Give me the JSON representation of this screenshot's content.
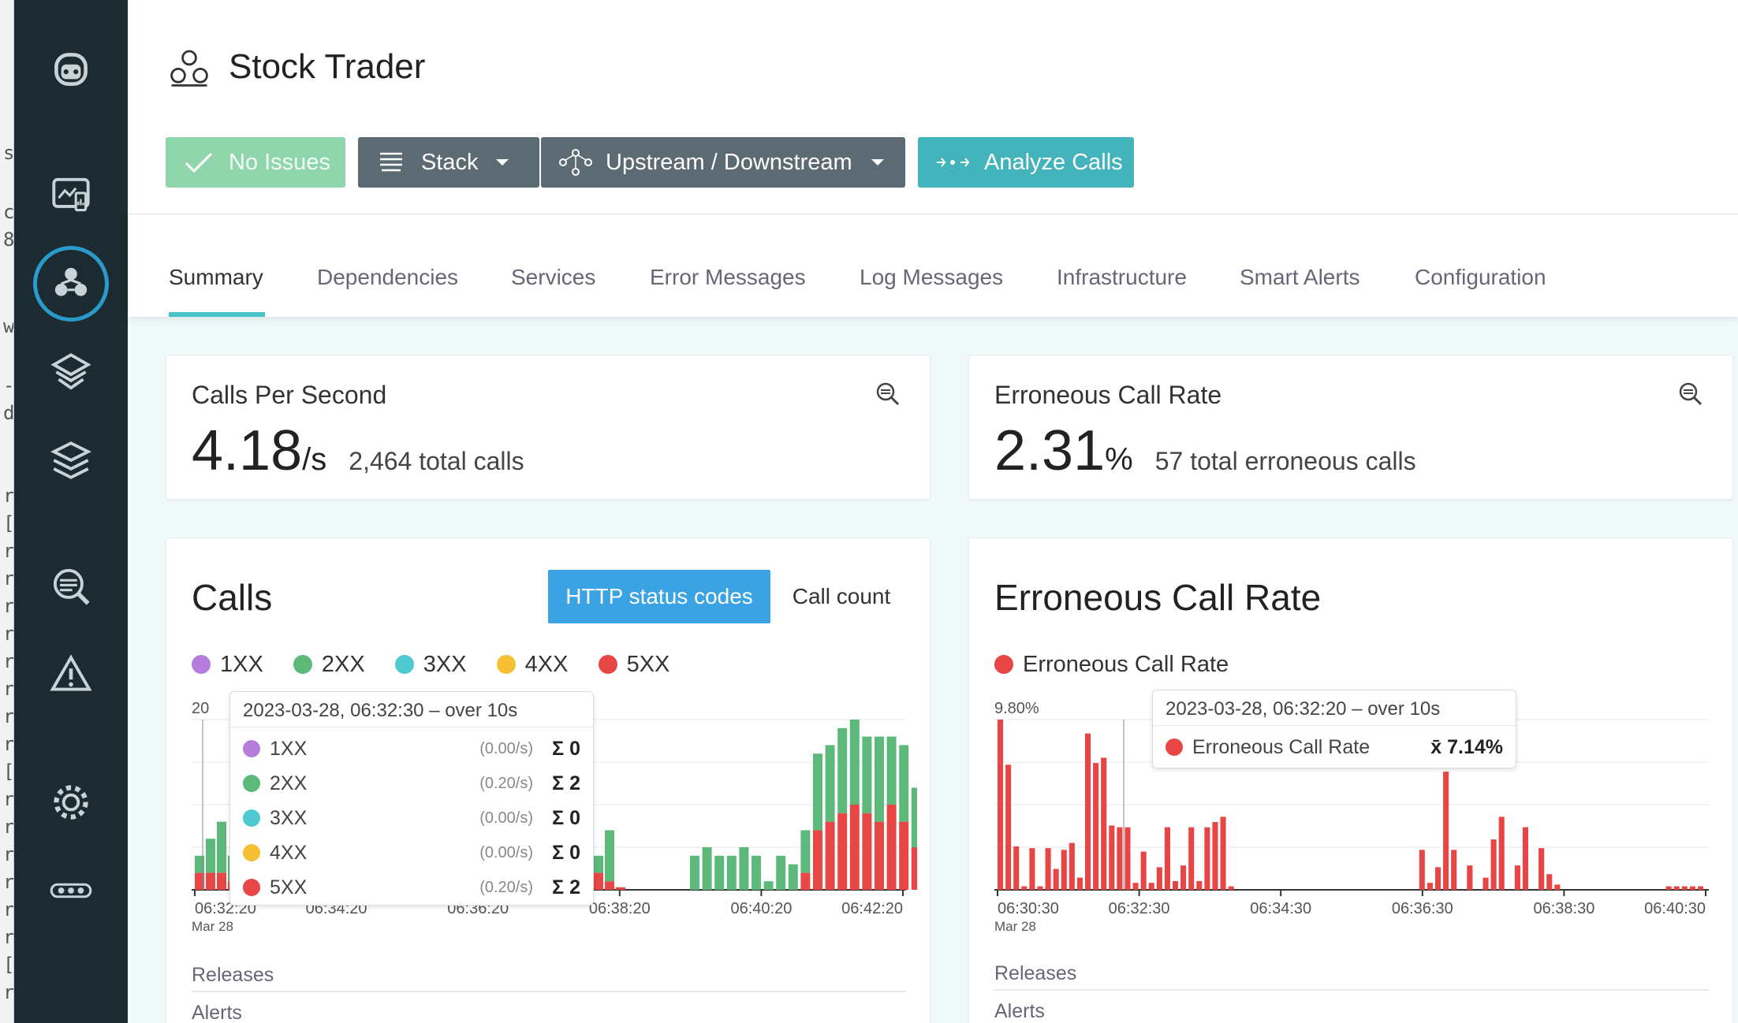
{
  "app": {
    "title": "Stock Trader"
  },
  "toolbar": {
    "no_issues": "No Issues",
    "stack": "Stack",
    "upstream": "Upstream / Downstream",
    "analyze": "Analyze Calls"
  },
  "tabs": [
    "Summary",
    "Dependencies",
    "Services",
    "Error Messages",
    "Log Messages",
    "Infrastructure",
    "Smart Alerts",
    "Configuration"
  ],
  "sidebar": {
    "icons": [
      "robot-logo-icon",
      "dashboard-icon",
      "application-icon",
      "service-icon",
      "layers-icon",
      "analyze-icon",
      "alert-icon",
      "settings-icon",
      "more-icon"
    ]
  },
  "kpi": {
    "calls": {
      "title": "Calls Per Second",
      "value": "4.18",
      "unit": "/s",
      "sub": "2,464 total calls"
    },
    "errors": {
      "title": "Erroneous Call Rate",
      "value": "2.31",
      "unit": "%",
      "sub": "57 total erroneous calls"
    }
  },
  "calls_card": {
    "title": "Calls",
    "toggle": [
      "HTTP status codes",
      "Call count"
    ],
    "releases": "Releases",
    "alerts": "Alerts",
    "tooltip": {
      "header": "2023-03-28, 06:32:30 – over 10s",
      "rows": [
        {
          "name": "1XX",
          "rate": "(0.00/s)",
          "sum": "0"
        },
        {
          "name": "2XX",
          "rate": "(0.20/s)",
          "sum": "2"
        },
        {
          "name": "3XX",
          "rate": "(0.00/s)",
          "sum": "0"
        },
        {
          "name": "4XX",
          "rate": "(0.00/s)",
          "sum": "0"
        },
        {
          "name": "5XX",
          "rate": "(0.20/s)",
          "sum": "2"
        }
      ]
    }
  },
  "err_card": {
    "title": "Erroneous Call Rate",
    "releases": "Releases",
    "alerts": "Alerts",
    "tooltip": {
      "header": "2023-03-28, 06:32:20 – over 10s",
      "name": "Erroneous Call Rate",
      "value": "7.14%"
    }
  },
  "colors": {
    "1XX": "#b57edc",
    "2XX": "#5cb97a",
    "3XX": "#4ec9d0",
    "4XX": "#f5c033",
    "5XX": "#e84545",
    "accent": "#48c1c8",
    "nav": "#1b2b31"
  },
  "chart_data": [
    {
      "type": "bar",
      "title": "Calls",
      "stacked": true,
      "ylim": [
        0,
        20
      ],
      "ytick_top": "20",
      "xticks": [
        "06:32:20",
        "06:34:20",
        "06:36:20",
        "06:38:20",
        "06:40:20",
        "06:42:20"
      ],
      "xdate": "Mar 28",
      "series": [
        {
          "name": "1XX",
          "values": [
            0,
            0,
            0,
            0,
            0,
            0,
            0,
            0,
            0,
            0,
            0,
            0,
            0,
            0,
            0,
            0,
            0,
            0,
            0,
            0,
            0,
            0,
            0,
            0,
            0,
            0,
            0,
            0,
            0,
            0,
            0,
            0,
            0,
            0,
            0,
            0,
            0,
            0,
            0,
            0,
            0,
            0,
            0,
            0,
            0,
            0,
            0,
            0,
            0,
            0,
            0,
            0,
            0,
            0,
            0,
            0,
            0,
            0,
            0,
            0,
            0,
            0,
            0,
            0,
            0
          ]
        },
        {
          "name": "2XX",
          "values": [
            2,
            4,
            6,
            3,
            2,
            1,
            0,
            0,
            0,
            0,
            0,
            0,
            0,
            0,
            0,
            0,
            0,
            0,
            0,
            0,
            0,
            0,
            0,
            0,
            0,
            0,
            0,
            0,
            0,
            0,
            0,
            0,
            0,
            0,
            0,
            0,
            0,
            0,
            0,
            0,
            2,
            6,
            0,
            0,
            0,
            0,
            0,
            0,
            0,
            0,
            0,
            0,
            0,
            0,
            0,
            0,
            0,
            0,
            0,
            0,
            0,
            0,
            0,
            0,
            0
          ]
        },
        {
          "name": "3XX",
          "values": [
            0,
            0,
            0,
            0,
            0,
            0,
            0,
            0,
            0,
            0,
            0,
            0,
            0,
            0,
            0,
            0,
            0,
            0,
            0,
            0,
            0,
            0,
            0,
            0,
            0,
            0,
            0,
            0,
            0,
            0,
            0,
            0,
            0,
            0,
            0,
            0,
            0,
            0,
            0,
            0,
            0,
            0,
            0,
            0,
            0,
            0,
            0,
            0,
            0,
            0,
            0,
            0,
            0,
            0,
            0,
            0,
            0,
            0,
            0,
            0,
            0,
            0,
            0,
            0,
            0
          ]
        },
        {
          "name": "4XX",
          "values": [
            0,
            0,
            0,
            0,
            0,
            0,
            0,
            0,
            0,
            0,
            0,
            0,
            0,
            0,
            0,
            0,
            0,
            0,
            0,
            0,
            0,
            0,
            0,
            0,
            0,
            0,
            0,
            0,
            0,
            0,
            0,
            0,
            0,
            0,
            0,
            0,
            0,
            0,
            0,
            0,
            0,
            0,
            0,
            0,
            0,
            0,
            0,
            0,
            0,
            0,
            0,
            0,
            0,
            0,
            0,
            0,
            0,
            0,
            0,
            0,
            0,
            0,
            0,
            0,
            0
          ]
        },
        {
          "name": "5XX",
          "values": [
            2,
            2,
            2,
            1,
            1,
            0,
            0,
            0,
            0,
            0,
            0,
            0,
            0,
            0,
            0,
            0,
            0,
            0,
            0,
            0,
            0,
            0,
            0,
            0,
            0,
            0,
            0,
            0,
            0,
            0,
            0,
            0,
            0,
            0,
            0,
            0,
            0,
            0,
            0,
            0,
            2,
            1,
            0.3,
            0,
            0,
            0,
            0,
            0,
            0,
            0,
            0,
            0,
            0,
            0,
            0,
            0,
            0,
            0,
            0,
            0,
            0,
            0,
            0,
            0,
            0
          ]
        }
      ],
      "bars_right": {
        "2XX": [
          4,
          5,
          4,
          4,
          5,
          4,
          1,
          4,
          3,
          5,
          9,
          9,
          10,
          10,
          9,
          10,
          8,
          9,
          7,
          6
        ],
        "5XX": [
          0,
          0,
          0,
          0,
          0,
          0,
          0,
          0,
          0,
          2,
          7,
          8,
          9,
          10,
          9,
          8,
          10,
          8,
          5,
          4
        ]
      }
    },
    {
      "type": "bar",
      "title": "Erroneous Call Rate",
      "series_name": "Erroneous Call Rate",
      "ytick_top": "9.80%",
      "ylim": [
        0,
        9.8
      ],
      "xticks": [
        "06:30:30",
        "06:32:30",
        "06:34:30",
        "06:36:30",
        "06:38:30",
        "06:40:30"
      ],
      "xdate": "Mar 28",
      "values": [
        9.8,
        7.2,
        2.5,
        0.2,
        2.4,
        0.2,
        2.4,
        1.2,
        2.3,
        2.7,
        0.7,
        9.0,
        7.3,
        7.6,
        3.7,
        3.6,
        3.6,
        0.4,
        2.2,
        0.4,
        1.3,
        3.6,
        0.5,
        1.4,
        3.6,
        0.5,
        3.6,
        3.9,
        4.2,
        0.2,
        0,
        0,
        0,
        0,
        0,
        0,
        0,
        0,
        0,
        0,
        0,
        0,
        0,
        0,
        0,
        0,
        0,
        0,
        0,
        0,
        0,
        0,
        0,
        2.3,
        0.4,
        1.3,
        6.8,
        2.3,
        0,
        1.4,
        0,
        0.7,
        2.9,
        4.2,
        0,
        1.4,
        3.6,
        0,
        2.4,
        0.9,
        0.3,
        0,
        0,
        0,
        0,
        0,
        0,
        0,
        0,
        0,
        0,
        0,
        0,
        0,
        0.2,
        0.2,
        0.2,
        0.2,
        0.2
      ]
    }
  ]
}
